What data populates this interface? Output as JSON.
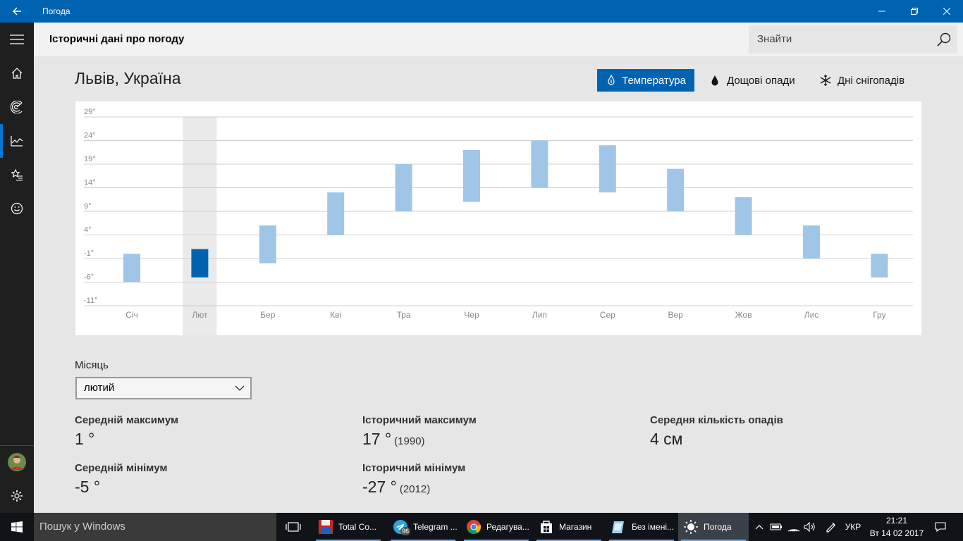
{
  "window": {
    "title": "Погода"
  },
  "header": {
    "page_title": "Історичні дані про погоду",
    "search_placeholder": "Знайти"
  },
  "location": "Львів, Україна",
  "tabs": [
    {
      "label": "Температура",
      "icon": "thermometer-drop-icon",
      "active": true
    },
    {
      "label": "Дощові опади",
      "icon": "raindrop-icon",
      "active": false
    },
    {
      "label": "Дні снігопадів",
      "icon": "snowflake-icon",
      "active": false
    }
  ],
  "chart_data": {
    "type": "bar",
    "title": "",
    "xlabel": "",
    "ylabel": "",
    "y_ticks": [
      "29°",
      "24°",
      "19°",
      "14°",
      "9°",
      "4°",
      "-1°",
      "-6°",
      "-11°"
    ],
    "ylim": [
      -11,
      29
    ],
    "categories": [
      "Січ",
      "Лют",
      "Бер",
      "Кві",
      "Тра",
      "Чер",
      "Лип",
      "Сер",
      "Вер",
      "Жов",
      "Лис",
      "Гру"
    ],
    "series": [
      {
        "name": "",
        "low": [
          -6,
          -5,
          -2,
          4,
          9,
          11,
          14,
          13,
          9,
          4,
          -1,
          -5
        ],
        "high": [
          0,
          1,
          6,
          13,
          19,
          22,
          24,
          23,
          18,
          12,
          6,
          0
        ]
      }
    ],
    "selected_category": "Лют",
    "grid": true,
    "colors": {
      "bar": "#9fc6e6",
      "selected_bar": "#0063b1",
      "selected_column": "#eaeaea"
    }
  },
  "month_selector": {
    "label": "Місяць",
    "value": "лютий"
  },
  "stats": {
    "avg_max_label": "Середній максимум",
    "avg_max_value": "1 °",
    "avg_min_label": "Середній мінімум",
    "avg_min_value": "-5 °",
    "record_max_label": "Історичний максимум",
    "record_max_value": "17 °",
    "record_max_year": "(1990)",
    "record_min_label": "Історичний мінімум",
    "record_min_value": "-27 °",
    "record_min_year": "(2012)",
    "avg_precip_label": "Середня кількість опадів",
    "avg_precip_value": "4 см"
  },
  "taskbar": {
    "search_placeholder": "Пошук у Windows",
    "apps": [
      {
        "label": "Total Co...",
        "icon": "floppy-disk-icon"
      },
      {
        "label": "Telegram ...",
        "icon": "telegram-icon",
        "badge": "96"
      },
      {
        "label": "Редагува...",
        "icon": "chrome-icon"
      },
      {
        "label": "Магазин",
        "icon": "store-icon"
      },
      {
        "label": "Без імені...",
        "icon": "paint-icon"
      },
      {
        "label": "Погода",
        "icon": "sun-icon",
        "active": true
      }
    ],
    "language": "УКР",
    "time": "21:21",
    "date": "Вт 14 02 2017"
  }
}
